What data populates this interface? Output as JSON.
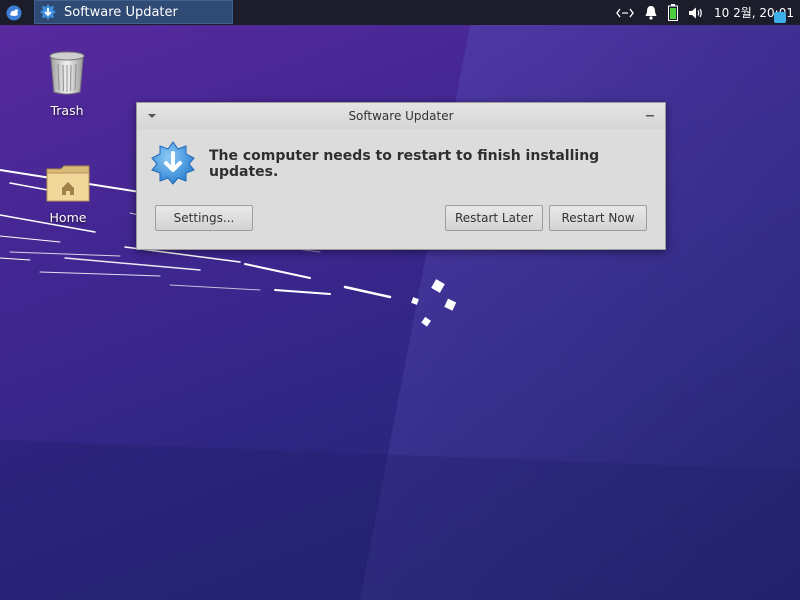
{
  "panel": {
    "app_menu_icon": "xubuntu-logo-icon",
    "task_button": {
      "label": "Software Updater",
      "icon": "software-updater-icon"
    },
    "tray": {
      "network_icon": "network-icon",
      "notification_icon": "bell-icon",
      "battery_icon": "battery-icon",
      "volume_icon": "volume-icon",
      "clock": "10 2월, 20:01"
    }
  },
  "desktop": {
    "icons": [
      {
        "label": "Trash",
        "icon": "trash-icon"
      },
      {
        "label": "Home",
        "icon": "home-folder-icon"
      }
    ]
  },
  "dialog": {
    "title": "Software Updater",
    "message": "The computer needs to restart to finish installing updates.",
    "buttons": {
      "settings": "Settings...",
      "restart_later": "Restart Later",
      "restart_now": "Restart Now"
    }
  },
  "colors": {
    "panel_bg": "#1b1d2b",
    "desktop_bg": "#3f2690",
    "accent": "#3daee9",
    "dialog_bg": "#dcdcdc"
  }
}
